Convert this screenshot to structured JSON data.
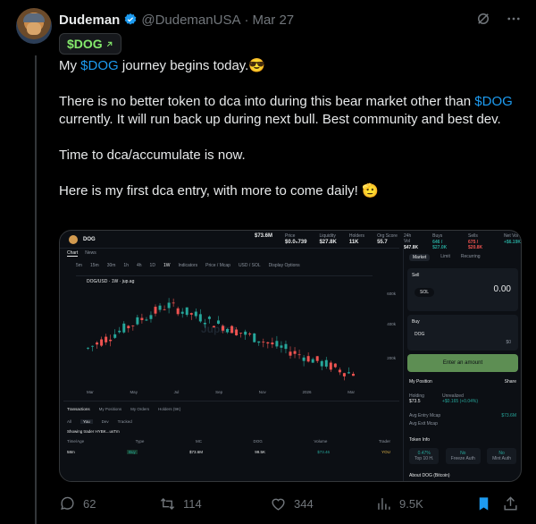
{
  "post": {
    "display_name": "Dudeman",
    "handle": "@DudemanUSA",
    "date": "Mar 27",
    "cashtag_pill": "$DOG",
    "text": {
      "line1_prefix": "My ",
      "line1_tag": "$DOG",
      "line1_suffix": " journey begins today.",
      "line1_emoji": "😎",
      "para2_prefix": "There is no better token to dca into during this bear market other than ",
      "para2_tag": "$DOG",
      "para2_suffix": " currently. It will run back up during next bull. Best community and best dev.",
      "para3": "Time to dca/accumulate is now.",
      "para4": "Here is my first dca entry, with more to come daily!",
      "para4_emoji": "🫡"
    }
  },
  "media": {
    "ticker": "DOG",
    "pair": "DOG/USD · 1W · jup.ag",
    "stats": [
      {
        "label": "Price",
        "value": "$0.0₅739"
      },
      {
        "label": "Liquidity",
        "value": "$27.8K"
      },
      {
        "label": "Holders",
        "value": "11K"
      },
      {
        "label": "Org Score",
        "value": "55.7"
      }
    ],
    "mcap": "$73.6M",
    "right_stats": [
      {
        "label": "24h Vol",
        "value": "$47.8K"
      },
      {
        "label": "Buys",
        "value": "646 / $27.0K"
      },
      {
        "label": "Sells",
        "value": "675 / $20.8K"
      },
      {
        "label": "Net Vol",
        "value": "+$6.19K"
      }
    ],
    "chart_tabs": [
      "Chart",
      "News"
    ],
    "timeframes": [
      "5m",
      "15m",
      "30m",
      "1h",
      "4h",
      "1D",
      "1W",
      "Indicators",
      "Price / Mcap",
      "USD / SOL",
      "Display Options"
    ],
    "y_ticks": [
      "600k",
      "400k",
      "200k"
    ],
    "x_ticks": [
      "Mar",
      "May",
      "Jul",
      "Sep",
      "Nov",
      "2026",
      "Mar"
    ],
    "watermark": "Jupiter",
    "tx_tabs": [
      "Transactions",
      "My Positions",
      "My Orders",
      "Holders (9K)"
    ],
    "tx_subtabs": [
      "All",
      "You",
      "Dev",
      "Tracked"
    ],
    "tx_note": "Showing trader HYBK...usTm",
    "tx_headers": [
      "Time/Age",
      "Type",
      "MC",
      "DOG",
      "Volume",
      "Trader"
    ],
    "tx_row": [
      "58m",
      "Buy",
      "$73.6M",
      "99.5K",
      "$73.46",
      "YOU"
    ],
    "side": {
      "tabs": [
        "Market",
        "Limit",
        "Recurring"
      ],
      "sell_label": "Sell",
      "sell_token": "SOL",
      "sell_amount": "0.00",
      "buy_label": "Buy",
      "buy_token": "DOG",
      "buy_amount": "$0",
      "button": "Enter an amount",
      "position_title": "My Position",
      "share": "Share",
      "holding_label": "Holding",
      "holding_value": "$73.5",
      "unrealized_label": "Unrealized",
      "unrealized_value": "+$0.165 (+0.04%)",
      "avg_entry": "Avg Entry Mcap",
      "avg_entry_value": "$73.6M",
      "avg_exit": "Avg Exit Mcap",
      "token_info": "Token Info",
      "info_stats": [
        {
          "label": "Top 10 H.",
          "value": "0.47%"
        },
        {
          "label": "Freeze Auth",
          "value": "No"
        },
        {
          "label": "Mint Auth",
          "value": "No"
        }
      ],
      "about": "About DOG (Bitcoin)"
    }
  },
  "actions": {
    "replies": "62",
    "reposts": "114",
    "likes": "344",
    "views": "9.5K"
  },
  "colors": {
    "accent": "#1d9bf0",
    "cashtag_green": "#84e96c",
    "muted": "#71767b",
    "candle_up": "#26a69a",
    "candle_down": "#ef5350"
  },
  "icons": [
    "verified-badge-icon",
    "grok-icon",
    "more-icon",
    "arrow-up-right-icon",
    "reply-icon",
    "repost-icon",
    "like-icon",
    "views-icon",
    "bookmark-icon",
    "share-icon"
  ]
}
